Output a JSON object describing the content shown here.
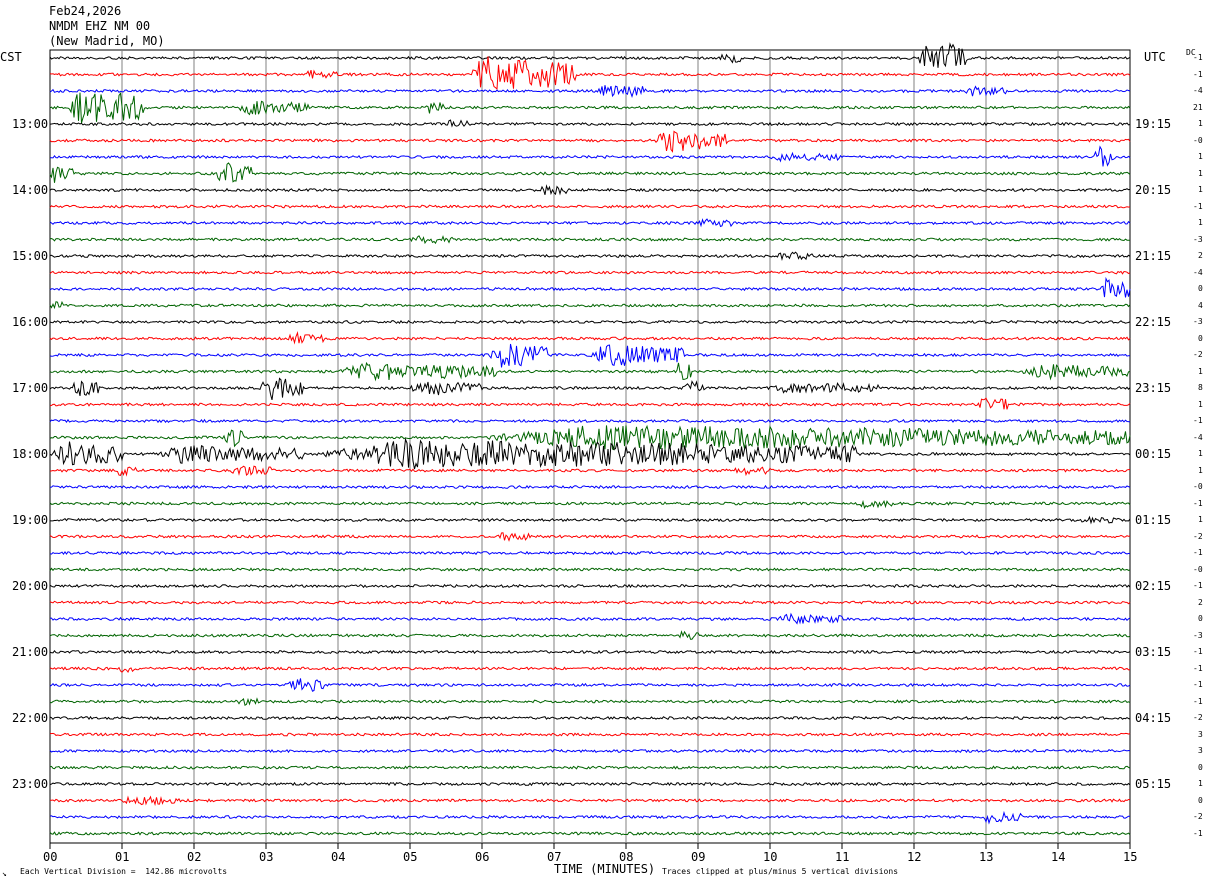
{
  "header": {
    "date": "Feb24,2026",
    "station": "NMDM EHZ NM 00",
    "location": "(New Madrid, MO)"
  },
  "left_tz": "CST",
  "right_tz": "UTC",
  "dc_label": "DC",
  "footer": {
    "scale_note": "Each Vertical Division =  142.86 microvolts",
    "xlabel": "TIME (MINUTES)",
    "clip_note": "Traces clipped at plus/minus 5 vertical divisions"
  },
  "colors": {
    "trace_cycle": [
      "#000000",
      "#ff0000",
      "#0000ff",
      "#006400"
    ],
    "grid": "#808080",
    "frame": "#000000"
  },
  "chart_data": {
    "type": "line",
    "title": "",
    "xlabel": "TIME (MINUTES)",
    "xlim": [
      0,
      15
    ],
    "x_ticks": [
      "00",
      "01",
      "02",
      "03",
      "04",
      "05",
      "06",
      "07",
      "08",
      "09",
      "10",
      "11",
      "12",
      "13",
      "14",
      "15"
    ],
    "trace_minutes": 15,
    "trace_count": 48,
    "left_hour_labels": [
      "13:00",
      "14:00",
      "15:00",
      "16:00",
      "17:00",
      "18:00",
      "19:00",
      "20:00",
      "21:00",
      "22:00",
      "23:00"
    ],
    "right_hour_labels": [
      "19:15",
      "20:15",
      "21:15",
      "22:15",
      "23:15",
      "00:15",
      "01:15",
      "02:15",
      "03:15",
      "04:15",
      "05:15"
    ],
    "dc_offsets": [
      "-1",
      "-1",
      "-4",
      "21",
      "1",
      "-0",
      "1",
      "1",
      "1",
      "-1",
      "1",
      "-3",
      "2",
      "-4",
      "0",
      "4",
      "-3",
      "0",
      "-2",
      "1",
      "8",
      "1",
      "-1",
      "-4",
      "1",
      "1",
      "-0",
      "-1",
      "1",
      "-2",
      "-1",
      "-0",
      "-1",
      "2",
      "0",
      "-3",
      "-1",
      "-1",
      "-1",
      "-1",
      "-2",
      "3",
      "3",
      "0",
      "1",
      "0",
      "-2",
      "-1"
    ],
    "events": [
      {
        "trace": 0,
        "start": 12.05,
        "end": 12.75,
        "amp": 2.2
      },
      {
        "trace": 0,
        "start": 9.3,
        "end": 9.6,
        "amp": 0.6
      },
      {
        "trace": 1,
        "start": 5.8,
        "end": 7.3,
        "amp": 2.3
      },
      {
        "trace": 1,
        "start": 3.5,
        "end": 4.0,
        "amp": 0.5
      },
      {
        "trace": 2,
        "start": 7.6,
        "end": 8.3,
        "amp": 0.8
      },
      {
        "trace": 2,
        "start": 12.7,
        "end": 13.3,
        "amp": 0.5
      },
      {
        "trace": 3,
        "start": 0.25,
        "end": 1.3,
        "amp": 2.4
      },
      {
        "trace": 3,
        "start": 2.6,
        "end": 3.6,
        "amp": 0.8
      },
      {
        "trace": 3,
        "start": 5.2,
        "end": 5.5,
        "amp": 0.8
      },
      {
        "trace": 4,
        "start": 5.5,
        "end": 5.8,
        "amp": 0.4
      },
      {
        "trace": 5,
        "start": 8.4,
        "end": 9.4,
        "amp": 1.3
      },
      {
        "trace": 6,
        "start": 10.0,
        "end": 11.0,
        "amp": 0.4
      },
      {
        "trace": 6,
        "start": 14.5,
        "end": 14.8,
        "amp": 1.2
      },
      {
        "trace": 7,
        "start": 0.0,
        "end": 0.35,
        "amp": 1.0
      },
      {
        "trace": 7,
        "start": 2.3,
        "end": 2.8,
        "amp": 1.3
      },
      {
        "trace": 8,
        "start": 6.8,
        "end": 7.2,
        "amp": 0.5
      },
      {
        "trace": 10,
        "start": 9.0,
        "end": 9.5,
        "amp": 0.4
      },
      {
        "trace": 11,
        "start": 5.0,
        "end": 5.6,
        "amp": 0.4
      },
      {
        "trace": 12,
        "start": 10.1,
        "end": 10.6,
        "amp": 0.4
      },
      {
        "trace": 14,
        "start": 14.6,
        "end": 15.0,
        "amp": 2.0
      },
      {
        "trace": 15,
        "start": 0.0,
        "end": 0.2,
        "amp": 0.6
      },
      {
        "trace": 17,
        "start": 3.3,
        "end": 3.8,
        "amp": 0.6
      },
      {
        "trace": 18,
        "start": 6.1,
        "end": 6.9,
        "amp": 1.6
      },
      {
        "trace": 18,
        "start": 7.5,
        "end": 8.8,
        "amp": 1.4
      },
      {
        "trace": 19,
        "start": 4.0,
        "end": 6.2,
        "amp": 1.0
      },
      {
        "trace": 19,
        "start": 8.7,
        "end": 8.9,
        "amp": 1.2
      },
      {
        "trace": 19,
        "start": 13.5,
        "end": 15.0,
        "amp": 0.8
      },
      {
        "trace": 20,
        "start": 0.3,
        "end": 0.7,
        "amp": 1.2
      },
      {
        "trace": 20,
        "start": 2.9,
        "end": 3.5,
        "amp": 1.4
      },
      {
        "trace": 20,
        "start": 5.0,
        "end": 6.0,
        "amp": 0.8
      },
      {
        "trace": 20,
        "start": 8.8,
        "end": 9.1,
        "amp": 1.0
      },
      {
        "trace": 20,
        "start": 10.0,
        "end": 11.5,
        "amp": 0.6
      },
      {
        "trace": 21,
        "start": 12.9,
        "end": 13.3,
        "amp": 1.0
      },
      {
        "trace": 23,
        "start": 2.4,
        "end": 2.7,
        "amp": 1.2
      },
      {
        "trace": 23,
        "start": 6.0,
        "end": 15.0,
        "amp": 1.4
      },
      {
        "trace": 24,
        "start": 0.0,
        "end": 1.0,
        "amp": 1.5
      },
      {
        "trace": 24,
        "start": 1.5,
        "end": 3.5,
        "amp": 1.0
      },
      {
        "trace": 24,
        "start": 3.7,
        "end": 11.2,
        "amp": 1.7
      },
      {
        "trace": 25,
        "start": 0.9,
        "end": 1.2,
        "amp": 0.5
      },
      {
        "trace": 25,
        "start": 2.5,
        "end": 3.1,
        "amp": 0.5
      },
      {
        "trace": 25,
        "start": 9.5,
        "end": 10.0,
        "amp": 0.5
      },
      {
        "trace": 27,
        "start": 11.2,
        "end": 11.7,
        "amp": 0.4
      },
      {
        "trace": 28,
        "start": 14.3,
        "end": 14.9,
        "amp": 0.3
      },
      {
        "trace": 29,
        "start": 6.2,
        "end": 6.7,
        "amp": 0.4
      },
      {
        "trace": 34,
        "start": 10.1,
        "end": 11.0,
        "amp": 0.5
      },
      {
        "trace": 35,
        "start": 8.7,
        "end": 9.1,
        "amp": 0.4
      },
      {
        "trace": 37,
        "start": 0.9,
        "end": 1.2,
        "amp": 0.4
      },
      {
        "trace": 38,
        "start": 3.3,
        "end": 3.8,
        "amp": 0.9
      },
      {
        "trace": 39,
        "start": 2.6,
        "end": 2.9,
        "amp": 0.4
      },
      {
        "trace": 45,
        "start": 1.0,
        "end": 1.8,
        "amp": 0.4
      },
      {
        "trace": 46,
        "start": 12.9,
        "end": 13.5,
        "amp": 0.6
      }
    ]
  }
}
